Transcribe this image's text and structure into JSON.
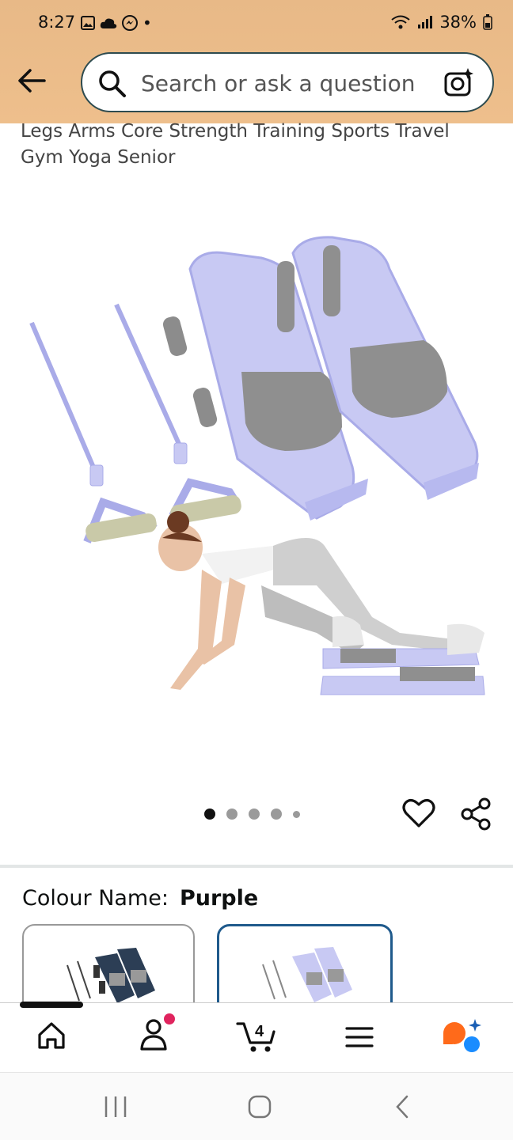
{
  "status_bar": {
    "time": "8:27",
    "battery": "38%"
  },
  "search": {
    "placeholder": "Search or ask a question"
  },
  "product": {
    "title": "Legs Arms Core Strength Training Sports Travel Gym Yoga Senior"
  },
  "carousel": {
    "total_dots": 5,
    "active_index": 0
  },
  "variant": {
    "label": "Colour Name:",
    "value": "Purple"
  },
  "bottom_nav": {
    "cart_count": "4"
  },
  "colors": {
    "header": "#eebf8c",
    "selected_border": "#1f5a8c",
    "product_purple": "#c8c9f3"
  },
  "icons": [
    "back-arrow-icon",
    "search-icon",
    "camera-icon",
    "heart-icon",
    "share-icon",
    "home-icon",
    "account-icon",
    "cart-icon",
    "menu-icon",
    "rufus-icon"
  ]
}
